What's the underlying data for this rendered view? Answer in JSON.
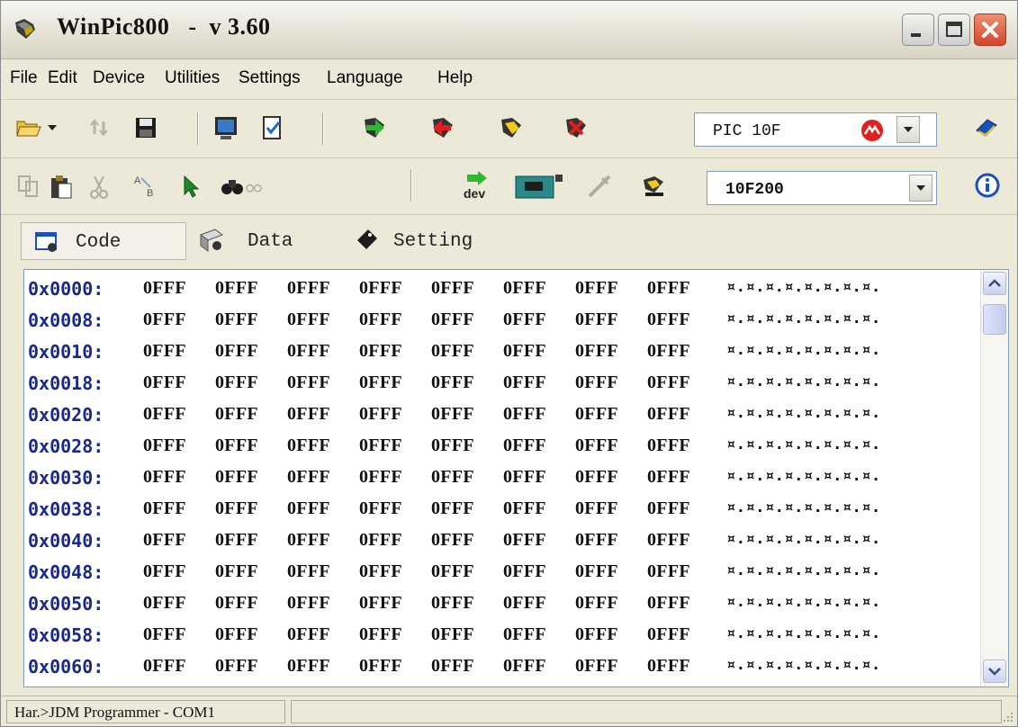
{
  "window": {
    "title": "WinPic800   -  v 3.60"
  },
  "menu": [
    "File",
    "Edit",
    "Device",
    "Utilities",
    "Settings",
    "Language",
    "Help"
  ],
  "toolbar": {
    "device_family": "PIC 10F",
    "device_model": "10F200"
  },
  "tabs": [
    {
      "label": "Code"
    },
    {
      "label": "Data"
    },
    {
      "label": "Setting"
    }
  ],
  "hex": {
    "rows": [
      {
        "addr": "0x0000:",
        "words": [
          "0FFF",
          "0FFF",
          "0FFF",
          "0FFF",
          "0FFF",
          "0FFF",
          "0FFF",
          "0FFF"
        ],
        "ascii": "¤.¤.¤.¤.¤.¤.¤.¤."
      },
      {
        "addr": "0x0008:",
        "words": [
          "0FFF",
          "0FFF",
          "0FFF",
          "0FFF",
          "0FFF",
          "0FFF",
          "0FFF",
          "0FFF"
        ],
        "ascii": "¤.¤.¤.¤.¤.¤.¤.¤."
      },
      {
        "addr": "0x0010:",
        "words": [
          "0FFF",
          "0FFF",
          "0FFF",
          "0FFF",
          "0FFF",
          "0FFF",
          "0FFF",
          "0FFF"
        ],
        "ascii": "¤.¤.¤.¤.¤.¤.¤.¤."
      },
      {
        "addr": "0x0018:",
        "words": [
          "0FFF",
          "0FFF",
          "0FFF",
          "0FFF",
          "0FFF",
          "0FFF",
          "0FFF",
          "0FFF"
        ],
        "ascii": "¤.¤.¤.¤.¤.¤.¤.¤."
      },
      {
        "addr": "0x0020:",
        "words": [
          "0FFF",
          "0FFF",
          "0FFF",
          "0FFF",
          "0FFF",
          "0FFF",
          "0FFF",
          "0FFF"
        ],
        "ascii": "¤.¤.¤.¤.¤.¤.¤.¤."
      },
      {
        "addr": "0x0028:",
        "words": [
          "0FFF",
          "0FFF",
          "0FFF",
          "0FFF",
          "0FFF",
          "0FFF",
          "0FFF",
          "0FFF"
        ],
        "ascii": "¤.¤.¤.¤.¤.¤.¤.¤."
      },
      {
        "addr": "0x0030:",
        "words": [
          "0FFF",
          "0FFF",
          "0FFF",
          "0FFF",
          "0FFF",
          "0FFF",
          "0FFF",
          "0FFF"
        ],
        "ascii": "¤.¤.¤.¤.¤.¤.¤.¤."
      },
      {
        "addr": "0x0038:",
        "words": [
          "0FFF",
          "0FFF",
          "0FFF",
          "0FFF",
          "0FFF",
          "0FFF",
          "0FFF",
          "0FFF"
        ],
        "ascii": "¤.¤.¤.¤.¤.¤.¤.¤."
      },
      {
        "addr": "0x0040:",
        "words": [
          "0FFF",
          "0FFF",
          "0FFF",
          "0FFF",
          "0FFF",
          "0FFF",
          "0FFF",
          "0FFF"
        ],
        "ascii": "¤.¤.¤.¤.¤.¤.¤.¤."
      },
      {
        "addr": "0x0048:",
        "words": [
          "0FFF",
          "0FFF",
          "0FFF",
          "0FFF",
          "0FFF",
          "0FFF",
          "0FFF",
          "0FFF"
        ],
        "ascii": "¤.¤.¤.¤.¤.¤.¤.¤."
      },
      {
        "addr": "0x0050:",
        "words": [
          "0FFF",
          "0FFF",
          "0FFF",
          "0FFF",
          "0FFF",
          "0FFF",
          "0FFF",
          "0FFF"
        ],
        "ascii": "¤.¤.¤.¤.¤.¤.¤.¤."
      },
      {
        "addr": "0x0058:",
        "words": [
          "0FFF",
          "0FFF",
          "0FFF",
          "0FFF",
          "0FFF",
          "0FFF",
          "0FFF",
          "0FFF"
        ],
        "ascii": "¤.¤.¤.¤.¤.¤.¤.¤."
      },
      {
        "addr": "0x0060:",
        "words": [
          "0FFF",
          "0FFF",
          "0FFF",
          "0FFF",
          "0FFF",
          "0FFF",
          "0FFF",
          "0FFF"
        ],
        "ascii": "¤.¤.¤.¤.¤.¤.¤.¤."
      }
    ]
  },
  "status": {
    "text": "Har.>JDM Programmer - COM1"
  },
  "icons": {
    "open": "folder-open-icon",
    "save": "floppy-disk-icon",
    "read": "green-chip-arrow-icon",
    "write": "red-chip-arrow-icon",
    "verify": "yellow-chip-icon",
    "erase": "red-chip-x-icon"
  }
}
